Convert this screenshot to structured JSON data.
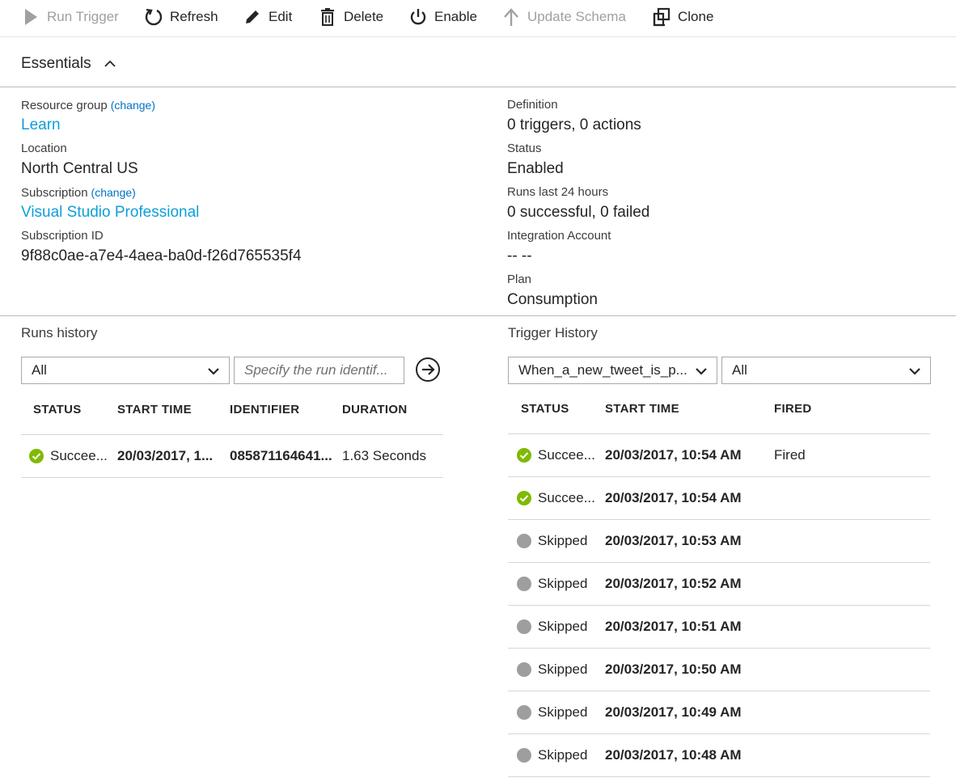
{
  "toolbar": {
    "run_trigger": "Run Trigger",
    "refresh": "Refresh",
    "edit": "Edit",
    "delete": "Delete",
    "enable": "Enable",
    "update_schema": "Update Schema",
    "clone": "Clone"
  },
  "essentials": {
    "title": "Essentials",
    "resource_group_label": "Resource group",
    "resource_group_change": "(change)",
    "resource_group_value": "Learn",
    "location_label": "Location",
    "location_value": "North Central US",
    "subscription_label": "Subscription",
    "subscription_change": "(change)",
    "subscription_value": "Visual Studio Professional",
    "subscription_id_label": "Subscription ID",
    "subscription_id_value": "9f88c0ae-a7e4-4aea-ba0d-f26d765535f4",
    "definition_label": "Definition",
    "definition_value": "0 triggers, 0 actions",
    "status_label": "Status",
    "status_value": "Enabled",
    "runs_label": "Runs last 24 hours",
    "runs_value": "0 successful, 0 failed",
    "integration_label": "Integration Account",
    "integration_value": "-- --",
    "plan_label": "Plan",
    "plan_value": "Consumption"
  },
  "runs_history": {
    "title": "Runs history",
    "filter_value": "All",
    "search_placeholder": "Specify the run identif...",
    "columns": [
      "STATUS",
      "START TIME",
      "IDENTIFIER",
      "DURATION"
    ],
    "rows": [
      {
        "status": "Succee...",
        "status_kind": "success",
        "start_time": "20/03/2017, 1...",
        "identifier": "085871164641...",
        "duration": "1.63 Seconds"
      }
    ]
  },
  "trigger_history": {
    "title": "Trigger History",
    "trigger_select": "When_a_new_tweet_is_p...",
    "filter_value": "All",
    "columns": [
      "STATUS",
      "START TIME",
      "FIRED"
    ],
    "rows": [
      {
        "status": "Succee...",
        "status_kind": "success",
        "start_time": "20/03/2017, 10:54 AM",
        "fired": "Fired"
      },
      {
        "status": "Succee...",
        "status_kind": "success",
        "start_time": "20/03/2017, 10:54 AM",
        "fired": ""
      },
      {
        "status": "Skipped",
        "status_kind": "skipped",
        "start_time": "20/03/2017, 10:53 AM",
        "fired": ""
      },
      {
        "status": "Skipped",
        "status_kind": "skipped",
        "start_time": "20/03/2017, 10:52 AM",
        "fired": ""
      },
      {
        "status": "Skipped",
        "status_kind": "skipped",
        "start_time": "20/03/2017, 10:51 AM",
        "fired": ""
      },
      {
        "status": "Skipped",
        "status_kind": "skipped",
        "start_time": "20/03/2017, 10:50 AM",
        "fired": ""
      },
      {
        "status": "Skipped",
        "status_kind": "skipped",
        "start_time": "20/03/2017, 10:49 AM",
        "fired": ""
      },
      {
        "status": "Skipped",
        "status_kind": "skipped",
        "start_time": "20/03/2017, 10:48 AM",
        "fired": ""
      }
    ]
  },
  "colors": {
    "link": "#0d9fd8",
    "success": "#7fba00",
    "skipped": "#9e9e9e",
    "disabled": "#a0a0a0"
  }
}
